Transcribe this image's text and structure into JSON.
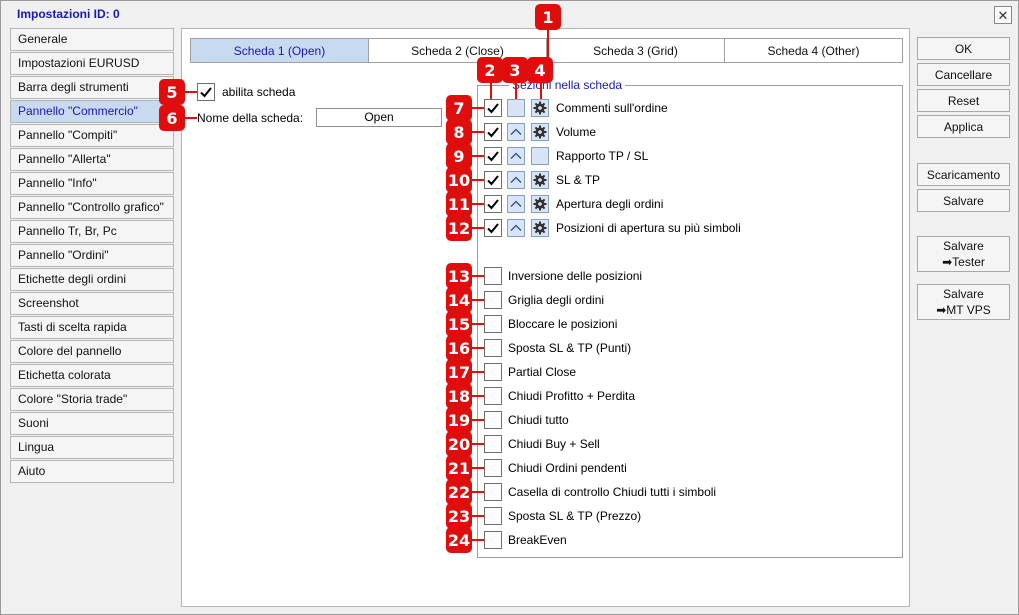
{
  "window": {
    "title": "Impostazioni   ID: 0"
  },
  "sidebar": {
    "items": [
      {
        "label": "Generale"
      },
      {
        "label": "Impostazioni EURUSD"
      },
      {
        "label": "Barra degli strumenti"
      },
      {
        "label": "Pannello \"Commercio\"",
        "active": true
      },
      {
        "label": "Pannello \"Compiti\""
      },
      {
        "label": "Pannello \"Allerta\""
      },
      {
        "label": "Pannello \"Info\""
      },
      {
        "label": "Pannello \"Controllo grafico\""
      },
      {
        "label": "Pannello Tr, Br, Pc"
      },
      {
        "label": "Pannello \"Ordini\""
      },
      {
        "label": "Etichette degli ordini"
      },
      {
        "label": "Screenshot"
      },
      {
        "label": "Tasti di scelta rapida"
      },
      {
        "label": "Colore del pannello"
      },
      {
        "label": "Etichetta colorata"
      },
      {
        "label": "Colore \"Storia trade\""
      },
      {
        "label": "Suoni"
      },
      {
        "label": "Lingua"
      },
      {
        "label": "Aiuto"
      }
    ]
  },
  "tabs": [
    {
      "label": "Scheda 1 (Open)",
      "active": true
    },
    {
      "label": "Scheda 2 (Close)"
    },
    {
      "label": "Scheda 3 (Grid)"
    },
    {
      "label": "Scheda 4 (Other)"
    }
  ],
  "settings": {
    "enable_label": "abilita scheda",
    "enable_checked": true,
    "name_label": "Nome della scheda:",
    "name_value": "Open"
  },
  "sections": {
    "title": "Sezioni nella scheda",
    "active_rows": [
      {
        "label": "Commenti sull'ordine",
        "checked": true,
        "has_up": false,
        "has_gear": true
      },
      {
        "label": "Volume",
        "checked": true,
        "has_up": true,
        "has_gear": true
      },
      {
        "label": "Rapporto TP / SL",
        "checked": true,
        "has_up": true,
        "has_gear": false
      },
      {
        "label": "SL & TP",
        "checked": true,
        "has_up": true,
        "has_gear": true
      },
      {
        "label": "Apertura degli ordini",
        "checked": true,
        "has_up": true,
        "has_gear": true
      },
      {
        "label": "Posizioni di apertura su più simboli",
        "checked": true,
        "has_up": true,
        "has_gear": true
      }
    ],
    "inactive_rows": [
      {
        "label": "Inversione delle posizioni",
        "checked": false
      },
      {
        "label": "Griglia degli ordini",
        "checked": false
      },
      {
        "label": "Bloccare le posizioni",
        "checked": false
      },
      {
        "label": "Sposta SL & TP (Punti)",
        "checked": false
      },
      {
        "label": "Partial Close",
        "checked": false
      },
      {
        "label": "Chiudi Profitto + Perdita",
        "checked": false
      },
      {
        "label": "Chiudi tutto",
        "checked": false
      },
      {
        "label": "Chiudi Buy + Sell",
        "checked": false
      },
      {
        "label": "Chiudi Ordini pendenti",
        "checked": false
      },
      {
        "label": "Casella di controllo Chiudi tutti i simboli",
        "checked": false
      },
      {
        "label": "Sposta SL & TP (Prezzo)",
        "checked": false
      },
      {
        "label": "BreakEven",
        "checked": false
      }
    ]
  },
  "buttons": {
    "ok": "OK",
    "cancel": "Cancellare",
    "reset": "Reset",
    "apply": "Applica",
    "download": "Scaricamento",
    "save": "Salvare",
    "save_tester_1": "Salvare",
    "save_tester_2": "➡Tester",
    "save_vps_1": "Salvare",
    "save_vps_2": "➡MT VPS"
  },
  "badges": {
    "group_title": "1",
    "checkbox_column": "2",
    "up_column": "3",
    "gear_column": "4",
    "enable": "5",
    "name": "6",
    "rows": [
      "7",
      "8",
      "9",
      "10",
      "11",
      "12",
      "13",
      "14",
      "15",
      "16",
      "17",
      "18",
      "19",
      "20",
      "21",
      "22",
      "23",
      "24"
    ]
  },
  "colors": {
    "accent": "#1a1ab0",
    "selected_bg": "#c7daf0",
    "badge": "#e00d0d"
  },
  "icons": {
    "check": "check-icon",
    "up": "chevron-up-icon",
    "gear": "gear-icon",
    "close": "close-icon"
  }
}
